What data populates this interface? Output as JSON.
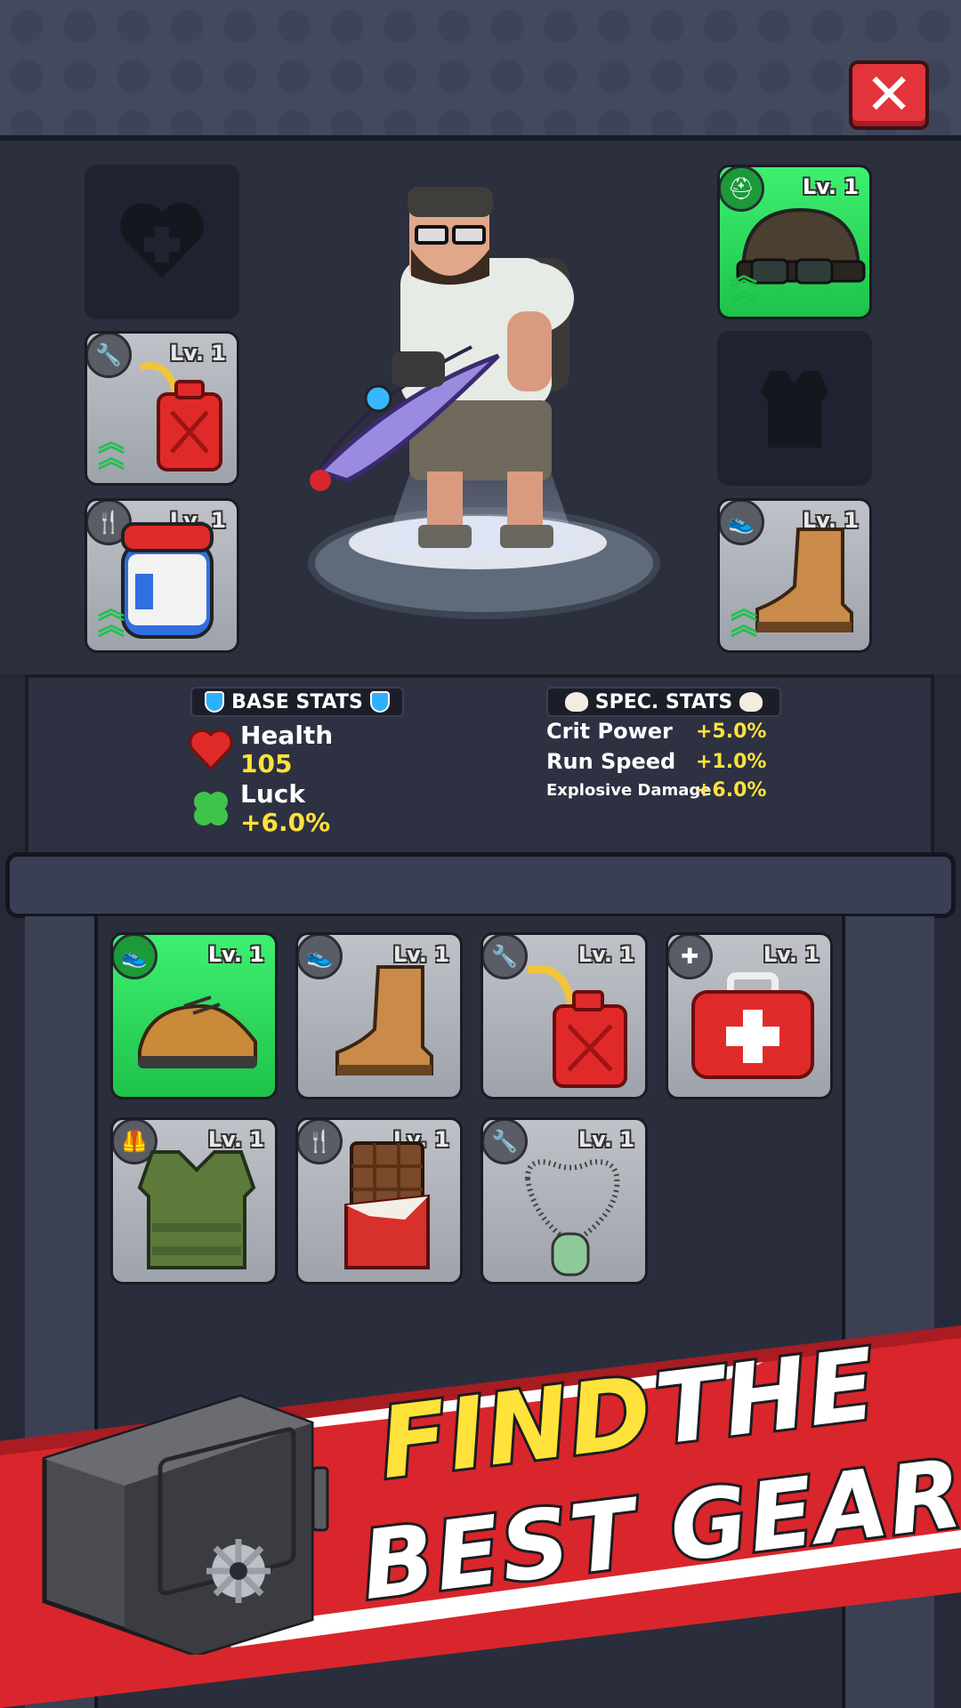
{
  "header": {
    "close_icon": "close-x-icon"
  },
  "equipment": {
    "left_slots": [
      {
        "state": "empty",
        "category_icon": "heart-plus-icon",
        "level": ""
      },
      {
        "state": "grey",
        "category_icon": "wrench-icon",
        "item_icon": "fuel-can-icon",
        "level": "Lv. 1"
      },
      {
        "state": "grey",
        "category_icon": "fork-knife-icon",
        "item_icon": "jar-icon",
        "level": "Lv. 1"
      }
    ],
    "right_slots": [
      {
        "state": "green",
        "category_icon": "helmet-icon",
        "item_icon": "helmet-goggles-icon",
        "level": "Lv. 1"
      },
      {
        "state": "empty",
        "category_icon": "vest-icon",
        "level": ""
      },
      {
        "state": "grey",
        "category_icon": "shoe-icon",
        "item_icon": "boot-icon",
        "level": "Lv. 1"
      }
    ],
    "character_icon": "crossbow-hunter-character"
  },
  "base_stats": {
    "title": "BASE STATS",
    "health_label": "Health",
    "health_value": "105",
    "luck_label": "Luck",
    "luck_value": "+6.0%"
  },
  "spec_stats": {
    "title": "SPEC. STATS",
    "rows": [
      {
        "label": "Crit Power",
        "value": "+5.0%"
      },
      {
        "label": "Run Speed",
        "value": "+1.0%"
      },
      {
        "label": "Explosive Damage",
        "value": "+6.0%"
      }
    ]
  },
  "inventory": {
    "items": [
      {
        "state": "green",
        "category_icon": "shoe-icon",
        "item_icon": "sneaker-icon",
        "level": "Lv. 1"
      },
      {
        "state": "grey",
        "category_icon": "shoe-icon",
        "item_icon": "boot-icon",
        "level": "Lv. 1"
      },
      {
        "state": "grey",
        "category_icon": "wrench-icon",
        "item_icon": "fuel-can-icon",
        "level": "Lv. 1"
      },
      {
        "state": "grey",
        "category_icon": "heart-plus-icon",
        "item_icon": "first-aid-kit-icon",
        "level": "Lv. 1"
      },
      {
        "state": "grey",
        "category_icon": "vest-icon",
        "item_icon": "armor-vest-icon",
        "level": "Lv. 1"
      },
      {
        "state": "grey",
        "category_icon": "fork-knife-icon",
        "item_icon": "chocolate-bar-icon",
        "level": "Lv. 1"
      },
      {
        "state": "grey",
        "category_icon": "wrench-icon",
        "item_icon": "dog-tag-icon",
        "level": "Lv. 1"
      }
    ]
  },
  "banner": {
    "line1_highlight": "FIND",
    "line1_rest": "THE",
    "line2": "BEST GEAR!",
    "colors": {
      "red": "#d8262c",
      "yellow": "#ffe23a",
      "white": "#ffffff"
    },
    "safe_icon": "safe-icon"
  }
}
